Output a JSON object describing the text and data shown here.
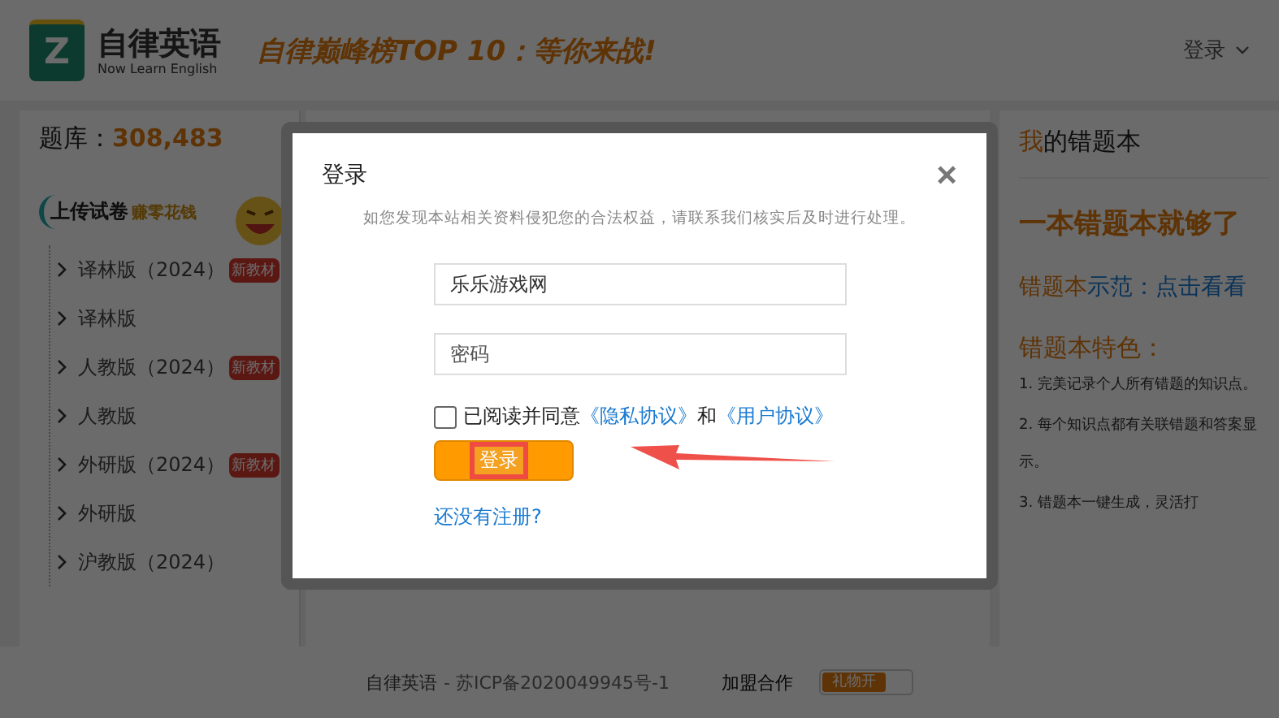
{
  "header": {
    "logo": {
      "letter": "Z",
      "title": "自律英语",
      "subtitle": "Now Learn English"
    },
    "banner": "自律巅峰榜TOP 10：等你来战!",
    "login_menu": "登录"
  },
  "left_panel": {
    "bank_label": "题库：",
    "bank_count": "308,483",
    "upload_banner": {
      "title": "上传试卷",
      "subtitle": "赚零花钱"
    },
    "tree": [
      {
        "label": "译林版（2024）",
        "badge": "新教材",
        "expanded": false
      },
      {
        "label": "译林版",
        "expanded": false
      },
      {
        "label": "人教版（2024）",
        "badge": "新教材",
        "expanded": false
      },
      {
        "label": "人教版",
        "expanded": false
      },
      {
        "label": "外研版（2024）",
        "badge": "新教材",
        "expanded": false
      },
      {
        "label": "外研版",
        "expanded": false
      },
      {
        "label": "沪教版（2024）",
        "expanded": false
      }
    ]
  },
  "right_panel": {
    "title_accent": "我",
    "title_rest": "的错题本",
    "headline": "一本错题本就够了",
    "demo_label": "错题本",
    "demo_link": "示范：点击看看",
    "features_heading": "错题本特色：",
    "features": [
      "1. 完美记录个人所有错题的知识点。",
      "2. 每个知识点都有关联错题和答案显示。",
      "3. 错题本一键生成，灵活打"
    ]
  },
  "footer": {
    "site": "自律英语",
    "icp": "- 苏ICP备2020049945号-1",
    "partner": "加盟合作",
    "gift_toggle": {
      "label": "礼物开",
      "on": true
    }
  },
  "dialog": {
    "title": "登录",
    "close": "×",
    "notice": "如您发现本站相关资料侵犯您的合法权益，请联系我们核实后及时进行处理。",
    "username": {
      "value": "乐乐游戏网"
    },
    "password": {
      "placeholder": "密码"
    },
    "agreement": {
      "checked": false,
      "text": "已阅读并同意",
      "privacy_link": "《隐私协议》",
      "joiner": "和",
      "user_link": "《用户协议》"
    },
    "login_button": "登录",
    "register_link": "还没有注册?"
  }
}
